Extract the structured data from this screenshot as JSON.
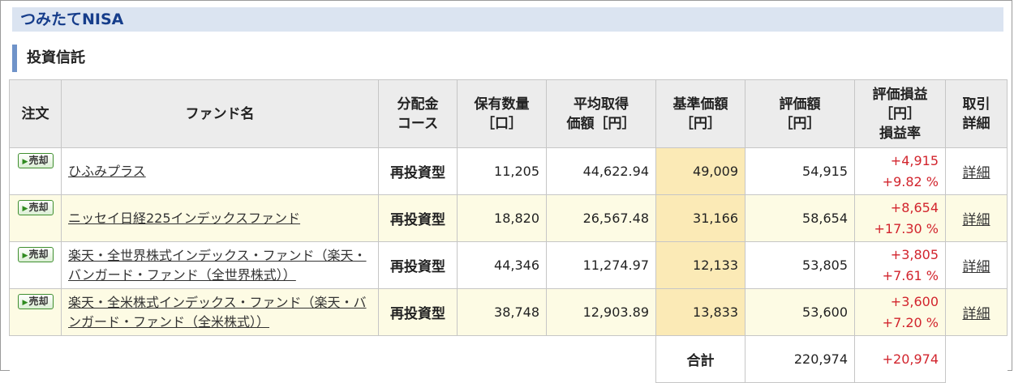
{
  "header": {
    "title": "つみたてNISA"
  },
  "section": {
    "title": "投資信託"
  },
  "columns": [
    "注文",
    "ファンド名",
    "分配金\nコース",
    "保有数量\n［口］",
    "平均取得\n価額［円］",
    "基準価額\n［円］",
    "評価額\n［円］",
    "評価損益\n［円］\n損益率",
    "取引\n詳細"
  ],
  "rows": [
    {
      "order": "売却",
      "fund": "ひふみプラス",
      "course": "再投資型",
      "quantity": "11,205",
      "avg_cost": "44,622.94",
      "nav": "49,009",
      "value": "54,915",
      "pl": "+4,915",
      "pl_rate": "+9.82 %",
      "detail": "詳細"
    },
    {
      "order": "売却",
      "fund": "ニッセイ日経225インデックスファンド",
      "course": "再投資型",
      "quantity": "18,820",
      "avg_cost": "26,567.48",
      "nav": "31,166",
      "value": "58,654",
      "pl": "+8,654",
      "pl_rate": "+17.30 %",
      "detail": "詳細"
    },
    {
      "order": "売却",
      "fund": "楽天・全世界株式インデックス・ファンド（楽天・バンガード・ファンド（全世界株式））",
      "course": "再投資型",
      "quantity": "44,346",
      "avg_cost": "11,274.97",
      "nav": "12,133",
      "value": "53,805",
      "pl": "+3,805",
      "pl_rate": "+7.61 %",
      "detail": "詳細"
    },
    {
      "order": "売却",
      "fund": "楽天・全米株式インデックス・ファンド（楽天・バンガード・ファンド（全米株式））",
      "course": "再投資型",
      "quantity": "38,748",
      "avg_cost": "12,903.89",
      "nav": "13,833",
      "value": "53,600",
      "pl": "+3,600",
      "pl_rate": "+7.20 %",
      "detail": "詳細"
    }
  ],
  "total": {
    "label": "合計",
    "value": "220,974",
    "pl": "+20,974"
  },
  "colors": {
    "header_bg": "#dbe4f1",
    "header_text": "#163d8b",
    "accent_bar": "#6f93c9",
    "profit": "#d2242d",
    "nav_highlight": "#fbeab6",
    "row_alt": "#fdfbe4"
  }
}
